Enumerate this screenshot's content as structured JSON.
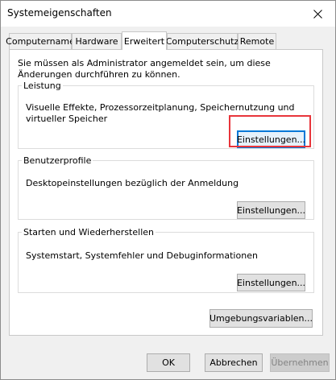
{
  "window": {
    "title": "Systemeigenschaften"
  },
  "tabs": [
    {
      "label": "Computername"
    },
    {
      "label": "Hardware"
    },
    {
      "label": "Erweitert",
      "active": true
    },
    {
      "label": "Computerschutz"
    },
    {
      "label": "Remote"
    }
  ],
  "admin_notice": "Sie müssen als Administrator angemeldet sein, um diese Änderungen durchführen zu können.",
  "groups": {
    "performance": {
      "title": "Leistung",
      "description": "Visuelle Effekte, Prozessorzeitplanung, Speichernutzung und virtueller Speicher",
      "button": "Einstellungen..."
    },
    "profiles": {
      "title": "Benutzerprofile",
      "description": "Desktopeinstellungen bezüglich der Anmeldung",
      "button": "Einstellungen..."
    },
    "startup": {
      "title": "Starten und Wiederherstellen",
      "description": "Systemstart, Systemfehler und Debuginformationen",
      "button": "Einstellungen..."
    }
  },
  "env_button": "Umgebungsvariablen...",
  "footer": {
    "ok": "OK",
    "cancel": "Abbrechen",
    "apply": "Übernehmen"
  },
  "colors": {
    "highlight": "#e8353b",
    "focus": "#0078d7"
  }
}
